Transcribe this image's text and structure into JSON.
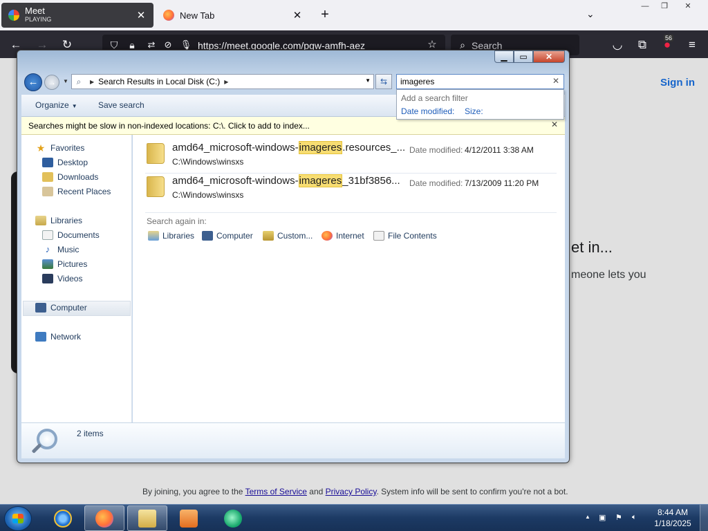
{
  "firefox": {
    "tabs": [
      {
        "title": "Meet",
        "subtitle": "PLAYING",
        "active": true
      },
      {
        "title": "New Tab",
        "subtitle": "",
        "active": false
      }
    ],
    "url": "https://meet.google.com/pgw-amfh-aez",
    "search_placeholder": "Search",
    "extension_badge": "56",
    "icons": [
      "back-arrow-icon",
      "forward-arrow-icon",
      "reload-icon",
      "shield-icon",
      "lock-icon",
      "permissions-icon",
      "autoplay-blocked-icon",
      "microphone-icon",
      "bookmark-star-icon",
      "search-icon",
      "pocket-icon",
      "extensions-icon",
      "menu-icon"
    ]
  },
  "meet": {
    "sign_in": "Sign in",
    "heading_partial": "et in...",
    "sub_partial": "meone lets you",
    "legal_prefix": "By joining, you agree to the",
    "terms": "Terms of Service",
    "and": "and",
    "privacy": "Privacy Policy",
    "legal_suffix": ". System info will be sent to confirm you're not a bot."
  },
  "explorer": {
    "address": "Search Results in Local Disk (C:)",
    "search_value": "imageres",
    "search_filter": {
      "title": "Add a search filter",
      "options": [
        "Date modified:",
        "Size:"
      ]
    },
    "toolbar": {
      "organize": "Organize",
      "save_search": "Save search"
    },
    "infobar": "Searches might be slow in non-indexed locations: C:\\. Click to add to index...",
    "nav": {
      "favorites": "Favorites",
      "favorites_items": [
        "Desktop",
        "Downloads",
        "Recent Places"
      ],
      "libraries": "Libraries",
      "libraries_items": [
        "Documents",
        "Music",
        "Pictures",
        "Videos"
      ],
      "computer": "Computer",
      "network": "Network"
    },
    "results": [
      {
        "name_prefix": "amd64_microsoft-windows-",
        "name_match": "imageres",
        "name_suffix": ".resources_...",
        "path": "C:\\Windows\\winsxs",
        "date_label": "Date modified:",
        "date": "4/12/2011 3:38 AM"
      },
      {
        "name_prefix": "amd64_microsoft-windows-",
        "name_match": "imageres",
        "name_suffix": "_31bf3856...",
        "path": "C:\\Windows\\winsxs",
        "date_label": "Date modified:",
        "date": "7/13/2009 11:20 PM"
      }
    ],
    "search_again": {
      "label": "Search again in:",
      "items": [
        "Libraries",
        "Computer",
        "Custom...",
        "Internet",
        "File Contents"
      ]
    },
    "status": "2 items"
  },
  "taskbar": {
    "time": "8:44 AM",
    "date": "1/18/2025",
    "pinned": [
      "internet-explorer",
      "firefox",
      "file-explorer",
      "media-player",
      "app"
    ]
  },
  "colors": {
    "firefox_navbar": "#2b2a33",
    "explorer_frame": "#c5d6ea",
    "highlight": "#f7dd72",
    "link_blue": "#1e5dba",
    "taskbar": "#1c3a64"
  }
}
